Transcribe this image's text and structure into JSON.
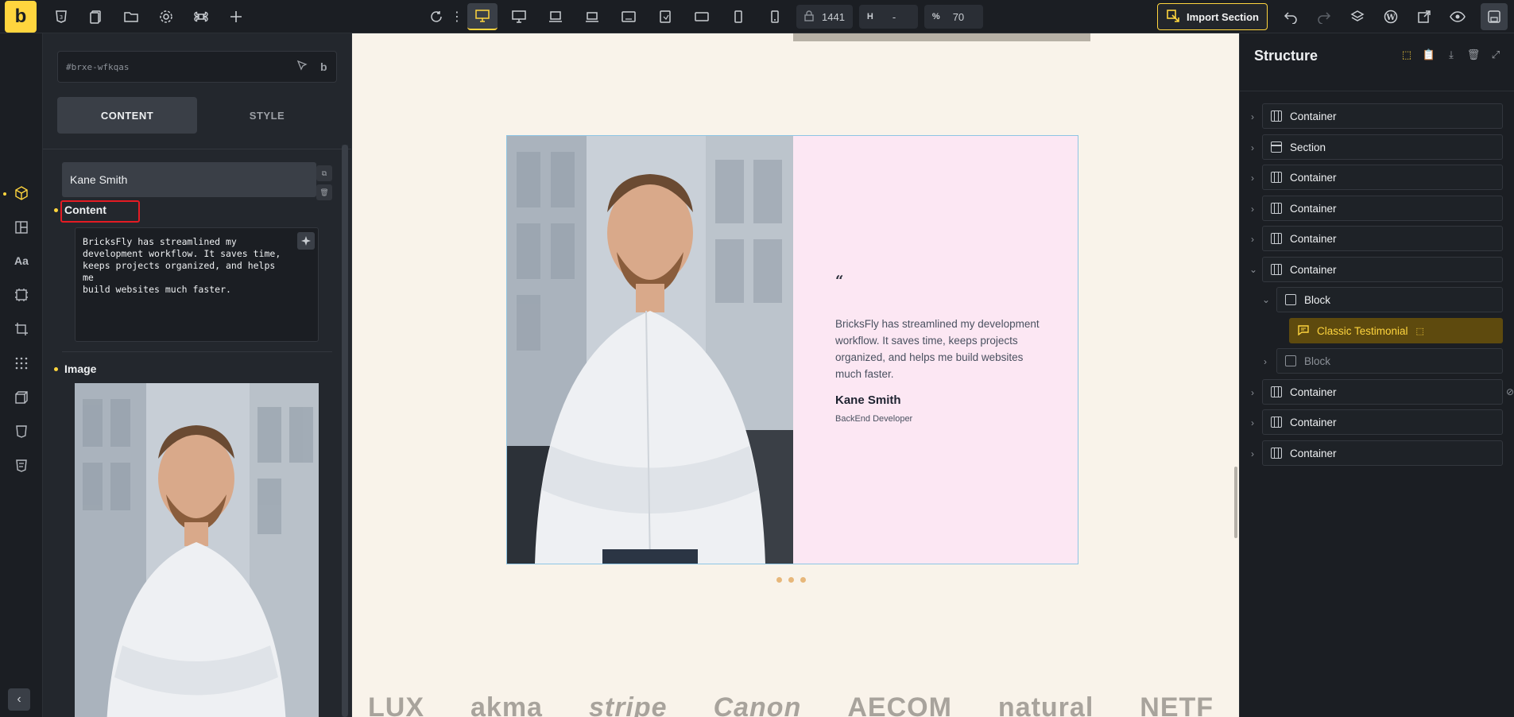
{
  "topbar": {
    "logo": "b",
    "width_value": "1441",
    "height_label": "H",
    "height_value": "-",
    "zoom_label": "%",
    "zoom_value": "70",
    "import_label": "Import Section"
  },
  "panel": {
    "element_id": "#brxe-wfkqas",
    "id_suffix": "b",
    "tabs": [
      "CONTENT",
      "STYLE"
    ],
    "repeater_item": "Kane Smith",
    "content_label": "Content",
    "content_text": "BricksFly has streamlined my\ndevelopment workflow. It saves time,\nkeeps projects organized, and helps me\nbuild websites much faster.",
    "image_label": "Image"
  },
  "canvas": {
    "quote_mark": "“",
    "quote": "BricksFly has streamlined my development workflow. It saves time, keeps projects organized, and helps me build websites much faster.",
    "name": "Kane Smith",
    "role": "BackEnd Developer",
    "logos": [
      "LUX",
      "akma",
      "stripe",
      "Canon",
      "AECOM",
      "natural",
      "NETF"
    ]
  },
  "structure": {
    "title": "Structure",
    "nodes": [
      {
        "label": "Container"
      },
      {
        "label": "Section"
      },
      {
        "label": "Container"
      },
      {
        "label": "Container"
      },
      {
        "label": "Container"
      },
      {
        "label": "Container"
      },
      {
        "label": "Block"
      },
      {
        "label": "Classic Testimonial"
      },
      {
        "label": "Block"
      },
      {
        "label": "Container"
      },
      {
        "label": "Container"
      },
      {
        "label": "Container"
      }
    ]
  }
}
